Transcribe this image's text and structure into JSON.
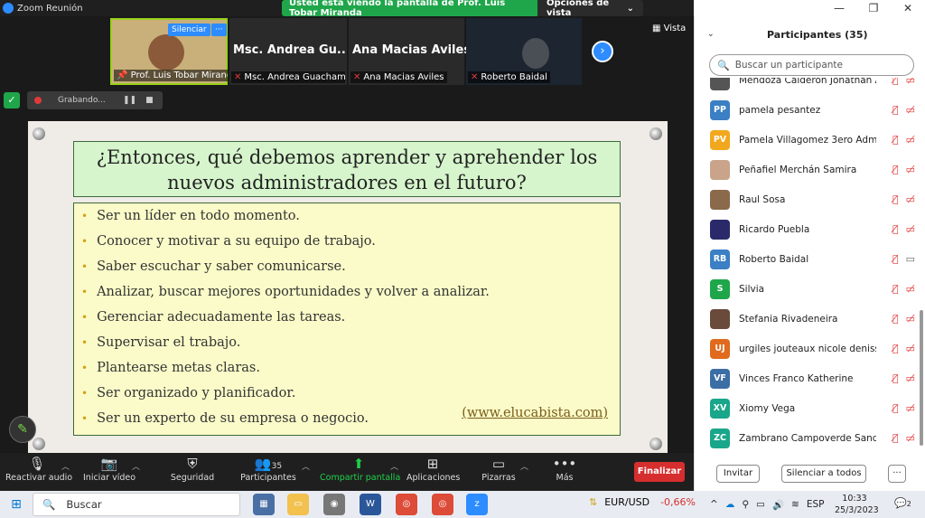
{
  "window": {
    "title": "Zoom Reunión",
    "controls": [
      "—",
      "❐",
      "✕"
    ]
  },
  "share_banner": {
    "message": "Usted está viendo la pantalla de Prof. Luis Tobar Miranda",
    "options": "Opciones de vista"
  },
  "gallery": {
    "tiles": [
      {
        "name": "Prof. Luis Tobar Mirand...",
        "big_name": "",
        "mute_btn": "Silenciar",
        "more_btn": "···"
      },
      {
        "name": "Msc. Andrea Guacham...",
        "big_name": "Msc. Andrea Gu..."
      },
      {
        "name": "Ana Macias Aviles",
        "big_name": "Ana Macias Aviles"
      },
      {
        "name": "Roberto Baidal",
        "big_name": ""
      }
    ],
    "next": "›",
    "view": "Vista"
  },
  "recording": {
    "label": "Grabando...",
    "pause": "❚❚",
    "stop": "■"
  },
  "slide": {
    "title": "¿Entonces, qué debemos aprender y aprehender los nuevos administradores en el futuro?",
    "bullets": [
      "Ser un líder en todo momento.",
      "Conocer y motivar a su equipo de trabajo.",
      "Saber escuchar y saber comunicarse.",
      "Analizar, buscar mejores oportunidades y volver a analizar.",
      "Gerenciar adecuadamente las tareas.",
      "Supervisar el trabajo.",
      "Plantearse metas claras.",
      "Ser organizado y planificador.",
      "Ser un experto de su empresa o negocio."
    ],
    "link": "(www.elucabista.com)"
  },
  "toolbar": {
    "unmute": "Reactivar audio",
    "start_video": "Iniciar vídeo",
    "security": "Seguridad",
    "participants": "Participantes",
    "participants_count": "35",
    "share": "Compartir pantalla",
    "apps": "Aplicaciones",
    "whiteboards": "Pizarras",
    "more": "Más",
    "end": "Finalizar"
  },
  "panel": {
    "title": "Participantes (35)",
    "search_placeholder": "Buscar un participante",
    "participants": [
      {
        "name": "Mendoza Calderon Jonathan A...",
        "initials": "",
        "color": "#555555",
        "video_on": false
      },
      {
        "name": "pamela pesantez",
        "initials": "PP",
        "color": "#3b7fc4",
        "video_on": false
      },
      {
        "name": "Pamela Villagomez  3ero Adm",
        "initials": "PV",
        "color": "#f2a81d",
        "video_on": false
      },
      {
        "name": "Peñafiel Merchán Samira",
        "initials": "",
        "color": "#c9a48a",
        "video_on": false
      },
      {
        "name": "Raul Sosa",
        "initials": "",
        "color": "#8a6a4a",
        "video_on": false
      },
      {
        "name": "Ricardo Puebla",
        "initials": "",
        "color": "#2a2a6a",
        "video_on": false
      },
      {
        "name": "Roberto Baidal",
        "initials": "RB",
        "color": "#3b7fc4",
        "video_on": true
      },
      {
        "name": "Silvia",
        "initials": "S",
        "color": "#1fa64a",
        "video_on": false
      },
      {
        "name": "Stefania Rivadeneira",
        "initials": "",
        "color": "#6a4a3a",
        "video_on": false
      },
      {
        "name": "urgiles jouteaux nicole denisse...",
        "initials": "UJ",
        "color": "#e06a1d",
        "video_on": false
      },
      {
        "name": "Vinces Franco Katherine",
        "initials": "VF",
        "color": "#3b6ea5",
        "video_on": false
      },
      {
        "name": "Xiomy Vega",
        "initials": "XV",
        "color": "#1aa68a",
        "video_on": false
      },
      {
        "name": "Zambrano Campoverde Sandra",
        "initials": "ZC",
        "color": "#1aa68a",
        "video_on": false
      }
    ],
    "invite": "Invitar",
    "mute_all": "Silenciar a todos",
    "more": "···"
  },
  "taskbar": {
    "search": "Buscar",
    "fx_label": "EUR/USD",
    "fx_change": "-0,66%",
    "lang": "ESP",
    "time": "10:33",
    "date": "25/3/2023",
    "notifications": "2"
  }
}
